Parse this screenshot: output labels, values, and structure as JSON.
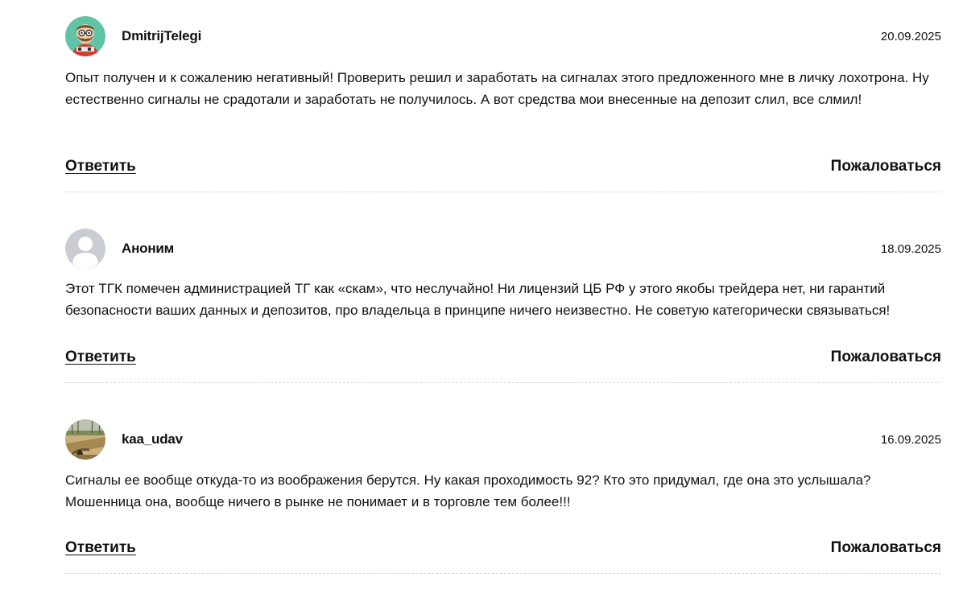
{
  "comments": [
    {
      "author": "DmitrijTelegi",
      "date": "20.09.2025",
      "avatar": "cartoon-man-avatar",
      "text": "Опыт получен и к сожалению негативный! Проверить решил и заработать на сигналах этого предложенного мне в личку лохотрона. Ну естественно сигналы не срадотали и заработать не получилось. А вот средства мои внесенные на депозит слил, все слмил!",
      "reply_label": "Ответить",
      "report_label": "Пожаловаться"
    },
    {
      "author": "Аноним",
      "date": "18.09.2025",
      "avatar": "default-user-avatar",
      "text": "Этот ТГК помечен администрацией ТГ как «скам», что неслучайно! Ни лицензий ЦБ РФ у этого якобы трейдера нет, ни гарантий безопасности ваших данных и депозитов, про владельца в принципе ничего неизвестно. Не советую категорически связываться!",
      "reply_label": "Ответить",
      "report_label": "Пожаловаться"
    },
    {
      "author": "kaa_udav",
      "date": "16.09.2025",
      "avatar": "landscape-photo-avatar",
      "text": "Сигналы ее вообще откуда-то из воображения берутся. Ну какая проходимость 92? Кто это придумал, где она это услышала? Мошенница она, вообще ничего в рынке не понимает и в торговле тем более!!!",
      "reply_label": "Ответить",
      "report_label": "Пожаловаться"
    }
  ],
  "colors": {
    "text": "#111111",
    "divider": "#d6d6d6",
    "default_avatar_bg": "#c9ccd3",
    "cartoon_avatar_bg": "#5fc3a6"
  }
}
